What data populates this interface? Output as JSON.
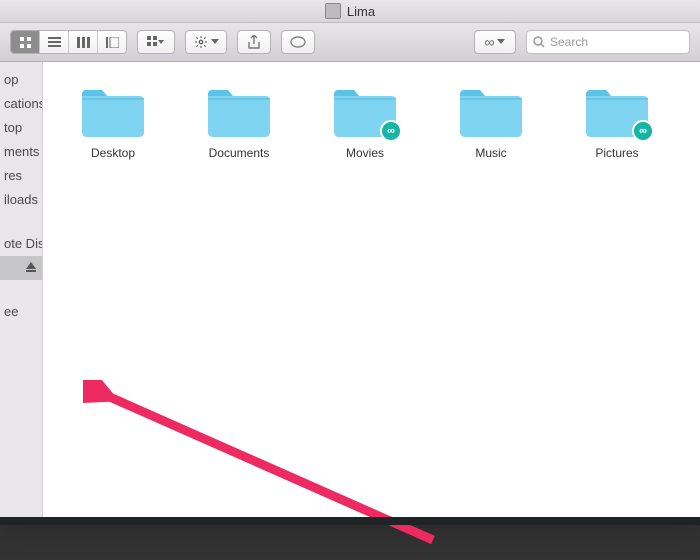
{
  "titlebar": {
    "title": "Lima"
  },
  "toolbar": {
    "search_placeholder": "Search"
  },
  "sidebar": {
    "items": [
      {
        "label": "op"
      },
      {
        "label": "cations"
      },
      {
        "label": "top"
      },
      {
        "label": "ments"
      },
      {
        "label": "res"
      },
      {
        "label": "iloads"
      }
    ],
    "devices": [
      {
        "label": "ote Disc"
      },
      {
        "label": "",
        "selected": true
      }
    ],
    "tags": [
      {
        "label": "ee"
      }
    ]
  },
  "folders": [
    {
      "name": "Desktop",
      "badge": false
    },
    {
      "name": "Documents",
      "badge": false
    },
    {
      "name": "Movies",
      "badge": true
    },
    {
      "name": "Music",
      "badge": false
    },
    {
      "name": "Pictures",
      "badge": true
    }
  ],
  "badge_glyph": "∞"
}
